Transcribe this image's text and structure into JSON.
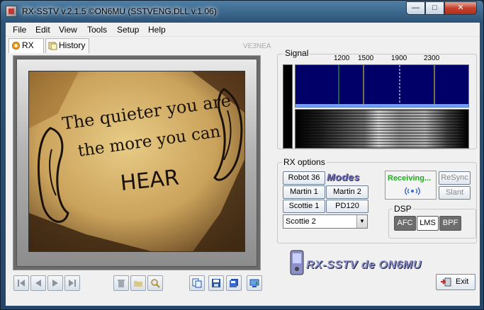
{
  "window": {
    "title": "RX-SSTV v.2.1.5 ©ON6MU (SSTVENG.DLL v.1.06)",
    "min_glyph": "—",
    "max_glyph": "□",
    "close_glyph": "✕"
  },
  "menu": [
    "File",
    "Edit",
    "View",
    "Tools",
    "Setup",
    "Help"
  ],
  "tabs": {
    "rx": "RX",
    "history": "History"
  },
  "callsign": "VE3NEA",
  "image": {
    "line1": "The quieter you are",
    "line2": "the more you can",
    "line3": "HEAR"
  },
  "signal": {
    "label": "Signal",
    "freqs": [
      "1200",
      "1500",
      "1900",
      "2300"
    ]
  },
  "rx_options": {
    "label": "RX options",
    "modes": [
      "Robot 36",
      "Martin 1",
      "Martin 2",
      "Scottie 1",
      "PD120"
    ],
    "modes_logo": "Modes",
    "selected_mode": "Scottie 2",
    "status": "Receiving...",
    "resync": "ReSync",
    "slant": "Slant"
  },
  "dsp": {
    "label": "DSP",
    "afc": "AFC",
    "lms": "LMS",
    "bpf": "BPF",
    "colors": {
      "afc": "#6d6d6d",
      "lms": "#ffffff",
      "bpf": "#6d6d6d"
    }
  },
  "logo_text": "RX-SSTV de ON6MU",
  "exit_label": "Exit"
}
